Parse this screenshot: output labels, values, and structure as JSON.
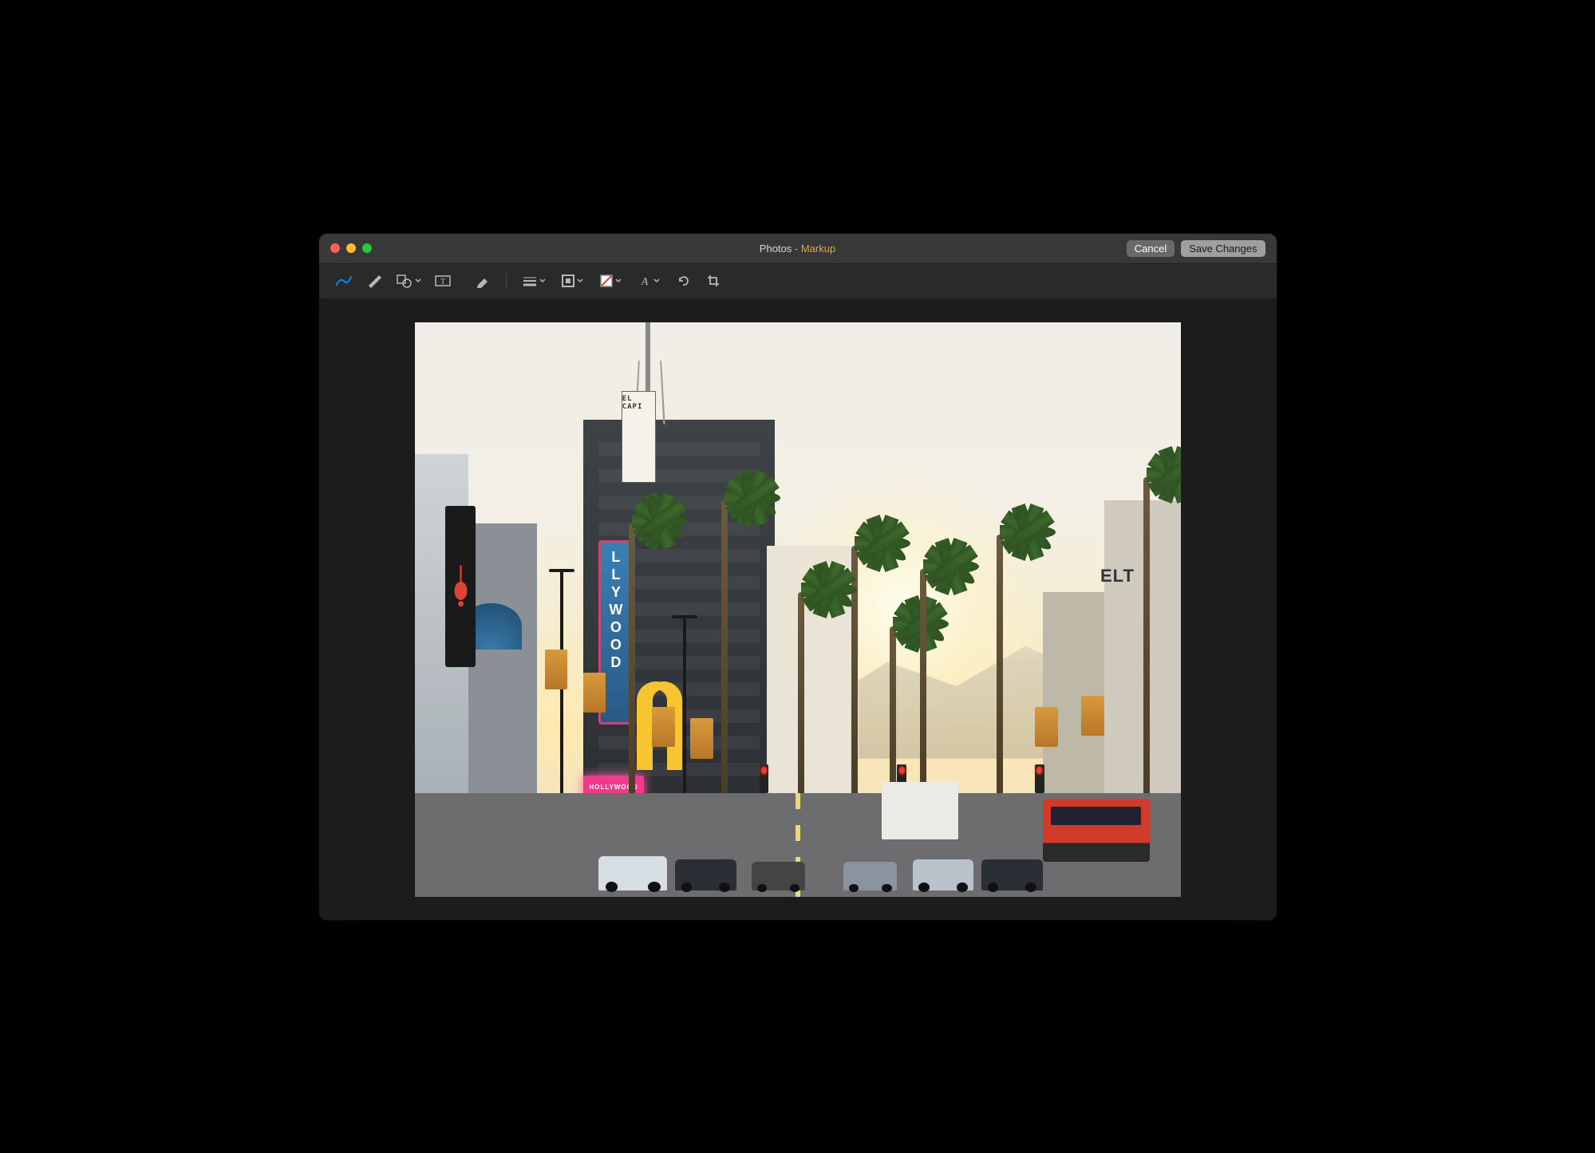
{
  "window": {
    "title_app": "Photos",
    "title_separator": " - ",
    "title_mode": "Markup",
    "cancel_label": "Cancel",
    "save_label": "Save Changes"
  },
  "toolbar": {
    "tools": [
      {
        "id": "sketch",
        "name": "sketch-tool-icon",
        "active": true,
        "dropdown": false
      },
      {
        "id": "draw",
        "name": "draw-tool-icon",
        "active": false,
        "dropdown": false
      },
      {
        "id": "shapes",
        "name": "shapes-tool-icon",
        "active": false,
        "dropdown": true
      },
      {
        "id": "text",
        "name": "text-tool-icon",
        "active": false,
        "dropdown": false
      },
      {
        "id": "highlight",
        "name": "highlight-tool-icon",
        "active": false,
        "dropdown": false
      },
      {
        "id": "line-weight",
        "name": "line-weight-icon",
        "active": false,
        "dropdown": true
      },
      {
        "id": "border-color",
        "name": "border-color-icon",
        "active": false,
        "dropdown": true
      },
      {
        "id": "fill-color",
        "name": "fill-color-icon",
        "active": false,
        "dropdown": true
      },
      {
        "id": "text-style",
        "name": "text-style-icon",
        "active": false,
        "dropdown": true
      },
      {
        "id": "rotate",
        "name": "rotate-left-icon",
        "active": false,
        "dropdown": false
      },
      {
        "id": "crop",
        "name": "crop-icon",
        "active": false,
        "dropdown": false
      }
    ],
    "divider_after": [
      "highlight"
    ]
  },
  "photo": {
    "signs": {
      "vertical_marquee": "LLYWOOD",
      "el_capitan": "EL CAPI",
      "neon_marquee": "HOLLYWOOD",
      "roosevelt_fragment": "ELT"
    }
  },
  "colors": {
    "accent": "#0a84ff",
    "title_mode": "#e0a92a",
    "fill_swatch": "#e53c2e"
  }
}
